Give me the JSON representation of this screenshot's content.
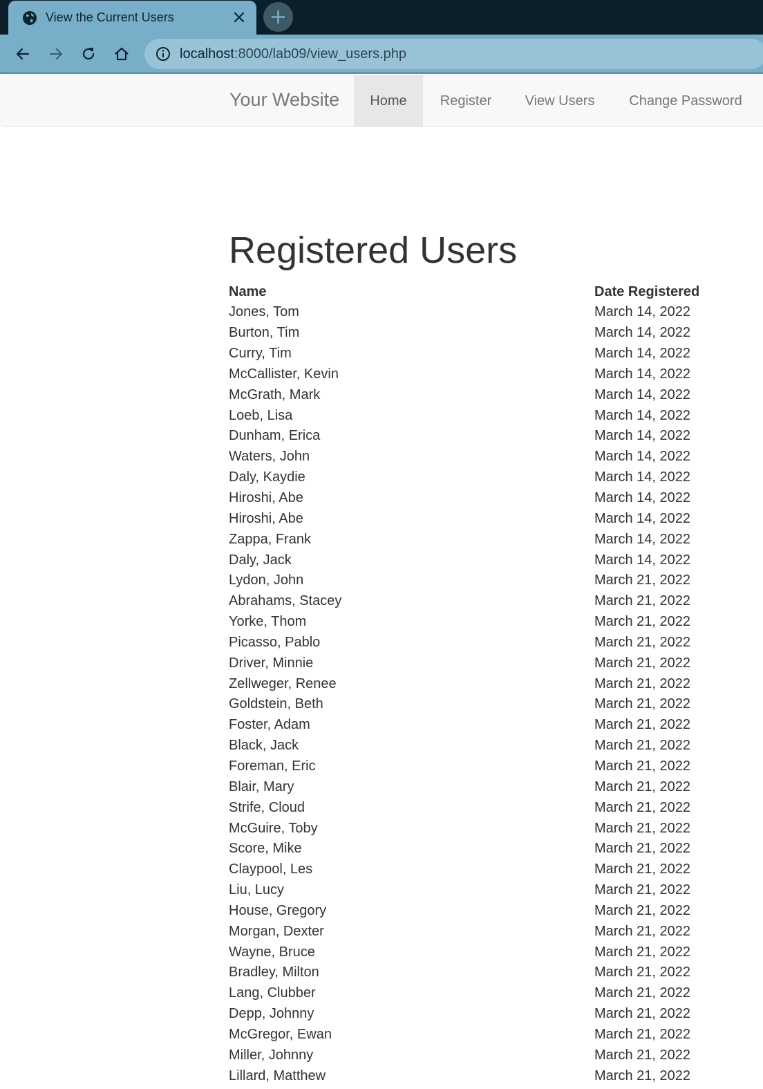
{
  "browser": {
    "tab_title": "View the Current Users",
    "url_host": "localhost",
    "url_rest": ":8000/lab09/view_users.php"
  },
  "navbar": {
    "brand": "Your Website",
    "links": [
      "Home",
      "Register",
      "View Users",
      "Change Password"
    ],
    "active": "Home"
  },
  "page": {
    "heading": "Registered Users"
  },
  "table": {
    "headers": [
      "Name",
      "Date Registered"
    ],
    "rows": [
      [
        "Jones, Tom",
        "March 14, 2022"
      ],
      [
        "Burton, Tim",
        "March 14, 2022"
      ],
      [
        "Curry, Tim",
        "March 14, 2022"
      ],
      [
        "McCallister, Kevin",
        "March 14, 2022"
      ],
      [
        "McGrath, Mark",
        "March 14, 2022"
      ],
      [
        "Loeb, Lisa",
        "March 14, 2022"
      ],
      [
        "Dunham, Erica",
        "March 14, 2022"
      ],
      [
        "Waters, John",
        "March 14, 2022"
      ],
      [
        "Daly, Kaydie",
        "March 14, 2022"
      ],
      [
        "Hiroshi, Abe",
        "March 14, 2022"
      ],
      [
        "Hiroshi, Abe",
        "March 14, 2022"
      ],
      [
        "Zappa, Frank",
        "March 14, 2022"
      ],
      [
        "Daly, Jack",
        "March 14, 2022"
      ],
      [
        "Lydon, John",
        "March 21, 2022"
      ],
      [
        "Abrahams, Stacey",
        "March 21, 2022"
      ],
      [
        "Yorke, Thom",
        "March 21, 2022"
      ],
      [
        "Picasso, Pablo",
        "March 21, 2022"
      ],
      [
        "Driver, Minnie",
        "March 21, 2022"
      ],
      [
        "Zellweger, Renee",
        "March 21, 2022"
      ],
      [
        "Goldstein, Beth",
        "March 21, 2022"
      ],
      [
        "Foster, Adam",
        "March 21, 2022"
      ],
      [
        "Black, Jack",
        "March 21, 2022"
      ],
      [
        "Foreman, Eric",
        "March 21, 2022"
      ],
      [
        "Blair, Mary",
        "March 21, 2022"
      ],
      [
        "Strife, Cloud",
        "March 21, 2022"
      ],
      [
        "McGuire, Toby",
        "March 21, 2022"
      ],
      [
        "Score, Mike",
        "March 21, 2022"
      ],
      [
        "Claypool, Les",
        "March 21, 2022"
      ],
      [
        "Liu, Lucy",
        "March 21, 2022"
      ],
      [
        "House, Gregory",
        "March 21, 2022"
      ],
      [
        "Morgan, Dexter",
        "March 21, 2022"
      ],
      [
        "Wayne, Bruce",
        "March 21, 2022"
      ],
      [
        "Bradley, Milton",
        "March 21, 2022"
      ],
      [
        "Lang, Clubber",
        "March 21, 2022"
      ],
      [
        "Depp, Johnny",
        "March 21, 2022"
      ],
      [
        "McGregor, Ewan",
        "March 21, 2022"
      ],
      [
        "Miller, Johnny",
        "March 21, 2022"
      ],
      [
        "Lillard, Matthew",
        "March 21, 2022"
      ]
    ]
  },
  "colors": {
    "tabstrip_bg": "#0b1f2a",
    "toolbar_bg": "#78aec8",
    "omnibox_bg": "#98c3d6",
    "navbar_bg": "#f8f8f8",
    "nav_active_bg": "#e7e7e7",
    "text": "#333333"
  },
  "icons": {
    "tab": "globe-icon",
    "close": "close-icon",
    "new_tab": "plus-icon",
    "back": "back-arrow-icon",
    "forward": "forward-arrow-icon",
    "reload": "reload-icon",
    "home": "home-icon",
    "site_info": "info-icon"
  }
}
